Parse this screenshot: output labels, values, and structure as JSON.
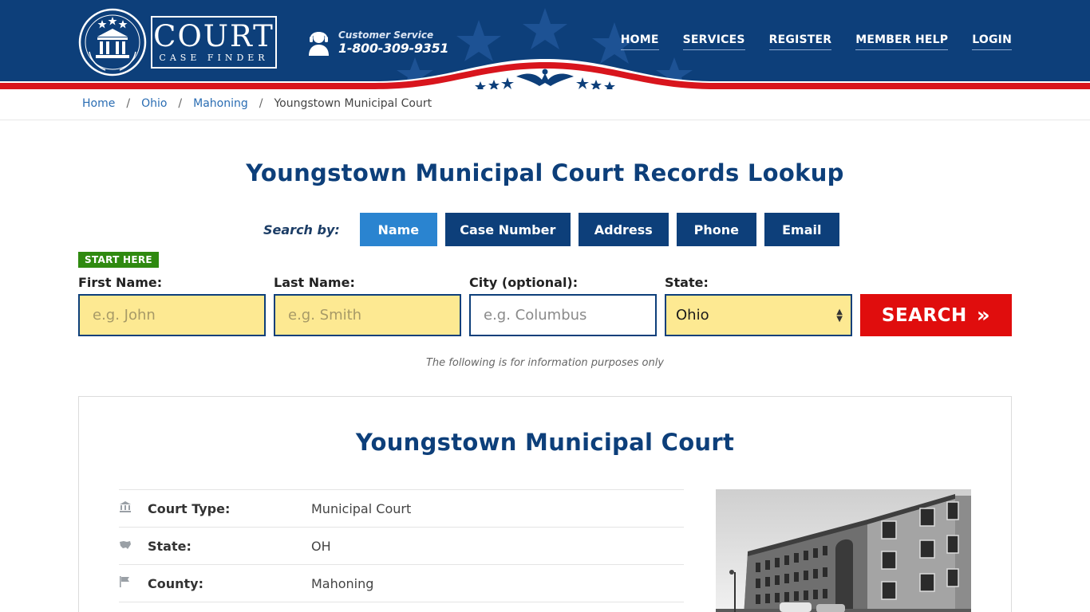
{
  "header": {
    "logo": {
      "word": "COURT",
      "sub": "CASE FINDER"
    },
    "customer_service": {
      "label": "Customer Service",
      "phone": "1-800-309-9351"
    },
    "nav": [
      "HOME",
      "SERVICES",
      "REGISTER",
      "MEMBER HELP",
      "LOGIN"
    ]
  },
  "breadcrumb": {
    "items": [
      "Home",
      "Ohio",
      "Mahoning"
    ],
    "current": "Youngstown Municipal Court",
    "separator": "/"
  },
  "page_title": "Youngstown Municipal Court Records Lookup",
  "search": {
    "by_label": "Search by:",
    "tabs": [
      "Name",
      "Case Number",
      "Address",
      "Phone",
      "Email"
    ],
    "active_tab": "Name",
    "start_here": "START HERE",
    "first_name": {
      "label": "First Name:",
      "placeholder": "e.g. John"
    },
    "last_name": {
      "label": "Last Name:",
      "placeholder": "e.g. Smith"
    },
    "city": {
      "label": "City (optional):",
      "placeholder": "e.g.  Columbus"
    },
    "state": {
      "label": "State:",
      "value": "Ohio"
    },
    "button": "SEARCH",
    "button_icon": "»",
    "note": "The following is for information purposes only"
  },
  "court": {
    "title": "Youngstown Municipal Court",
    "rows": [
      {
        "icon": "courthouse-icon",
        "key": "Court Type:",
        "value": "Municipal Court"
      },
      {
        "icon": "us-map-icon",
        "key": "State:",
        "value": "OH"
      },
      {
        "icon": "flag-icon",
        "key": "County:",
        "value": "Mahoning"
      }
    ]
  },
  "colors": {
    "navy": "#0d3f7a",
    "active_tab": "#2a84d0",
    "search_red": "#e00d0d",
    "field_yellow": "#fde992",
    "start_green": "#2f8a10"
  }
}
